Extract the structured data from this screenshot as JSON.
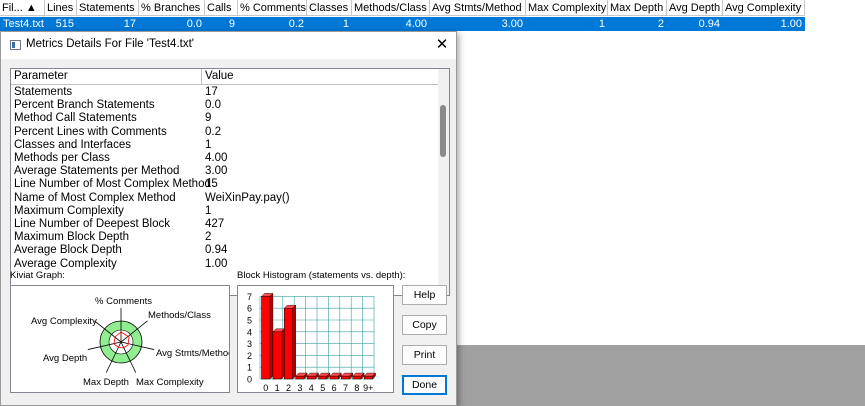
{
  "main_table": {
    "columns": [
      "Fil... ▲",
      "Lines",
      "Statements",
      "% Branches",
      "Calls",
      "% Comments",
      "Classes",
      "Methods/Class",
      "Avg Stmts/Method",
      "Max Complexity",
      "Max Depth",
      "Avg Depth",
      "Avg Complexity"
    ],
    "row": [
      "Test4.txt",
      "515",
      "17",
      "0.0",
      "9",
      "0.2",
      "1",
      "4.00",
      "3.00",
      "1",
      "2",
      "0.94",
      "1.00"
    ]
  },
  "dialog": {
    "title": "Metrics Details For File 'Test4.txt'",
    "close_glyph": "✕",
    "table_headers": {
      "parameter": "Parameter",
      "value": "Value"
    },
    "rows": [
      {
        "k": "Statements",
        "v": "17"
      },
      {
        "k": "Percent Branch Statements",
        "v": "0.0"
      },
      {
        "k": "Method Call Statements",
        "v": "9"
      },
      {
        "k": "Percent Lines with Comments",
        "v": "0.2"
      },
      {
        "k": "Classes and Interfaces",
        "v": "1"
      },
      {
        "k": "Methods per Class",
        "v": "4.00"
      },
      {
        "k": "Average Statements per Method",
        "v": "3.00"
      },
      {
        "k": "Line Number of Most Complex Method",
        "v": "15"
      },
      {
        "k": "Name of Most Complex Method",
        "v": "WeiXinPay.pay()"
      },
      {
        "k": "Maximum Complexity",
        "v": "1"
      },
      {
        "k": "Line Number of Deepest Block",
        "v": "427"
      },
      {
        "k": "Maximum Block Depth",
        "v": "2"
      },
      {
        "k": "Average Block Depth",
        "v": "0.94"
      },
      {
        "k": "Average Complexity",
        "v": "1.00"
      }
    ],
    "kiviat": {
      "label": "Kiviat Graph:",
      "axes": [
        "% Comments",
        "Methods/Class",
        "Avg Stmts/Method",
        "Max Complexity",
        "Max Depth",
        "Avg Depth",
        "Avg Complexity"
      ]
    },
    "histogram": {
      "label": "Block Histogram (statements vs. depth):",
      "y_ticks": [
        "7",
        "6",
        "5",
        "4",
        "3",
        "2",
        "1",
        "0"
      ],
      "x_ticks": [
        "0",
        "1",
        "2",
        "3",
        "4",
        "5",
        "6",
        "7",
        "8",
        "9+"
      ],
      "bar_color": "#ff0000"
    },
    "buttons": {
      "help": "Help",
      "copy": "Copy",
      "print": "Print",
      "done": "Done"
    }
  },
  "chart_data": {
    "type": "bar",
    "title": "Block Histogram (statements vs. depth):",
    "categories": [
      "0",
      "1",
      "2",
      "3",
      "4",
      "5",
      "6",
      "7",
      "8",
      "9+"
    ],
    "values": [
      7,
      4,
      6,
      0,
      0,
      0,
      0,
      0,
      0,
      0
    ],
    "ylim": [
      0,
      7
    ],
    "grid": true
  },
  "colors": {
    "selection": "#0078d7",
    "kiviat_fill": "#90ee90"
  }
}
